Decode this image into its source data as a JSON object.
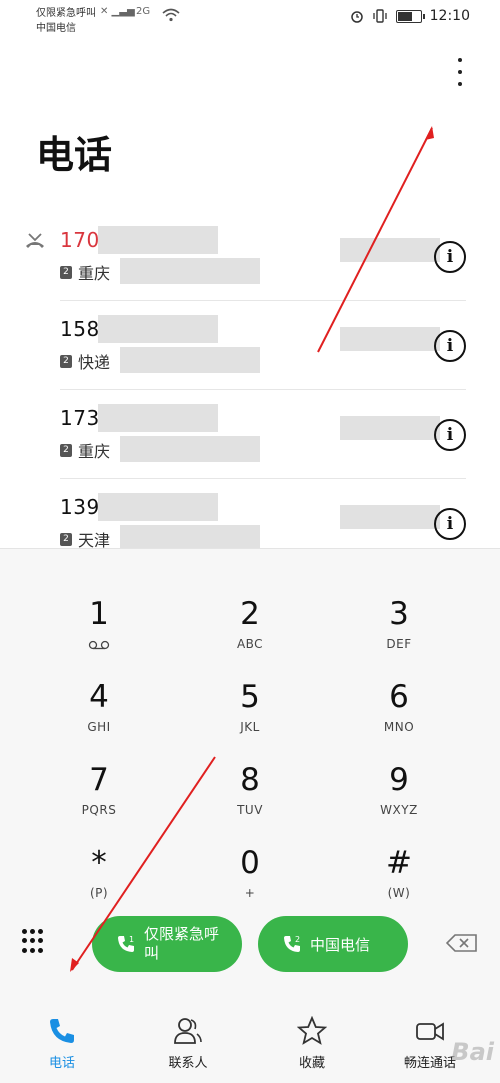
{
  "status_bar": {
    "carrier_line1": "仅限紧急呼叫",
    "carrier_line2": "中国电信",
    "network": "2G",
    "time": "12:10",
    "battery_level": 0.7
  },
  "header": {
    "title": "电话"
  },
  "call_log": [
    {
      "number": "170",
      "location": "重庆",
      "missed": true
    },
    {
      "number": "158",
      "location": "快递",
      "missed": false
    },
    {
      "number": "173",
      "location": "重庆",
      "missed": false
    },
    {
      "number": "139",
      "location": "天津",
      "missed": false
    }
  ],
  "info_glyph": "i",
  "dialpad": {
    "keys": [
      {
        "digit": "1",
        "letters": ""
      },
      {
        "digit": "2",
        "letters": "ABC"
      },
      {
        "digit": "3",
        "letters": "DEF"
      },
      {
        "digit": "4",
        "letters": "GHI"
      },
      {
        "digit": "5",
        "letters": "JKL"
      },
      {
        "digit": "6",
        "letters": "MNO"
      },
      {
        "digit": "7",
        "letters": "PQRS"
      },
      {
        "digit": "8",
        "letters": "TUV"
      },
      {
        "digit": "9",
        "letters": "WXYZ"
      },
      {
        "digit": "*",
        "letters": "(P)"
      },
      {
        "digit": "0",
        "letters": "+"
      },
      {
        "digit": "#",
        "letters": "(W)"
      }
    ],
    "call_buttons": [
      {
        "sim": "1",
        "label_line1": "仅限紧急呼",
        "label_line2": "叫"
      },
      {
        "sim": "2",
        "label_line1": "中国电信",
        "label_line2": ""
      }
    ]
  },
  "bottom_nav": [
    {
      "label": "电话",
      "icon": "phone-icon",
      "active": true
    },
    {
      "label": "联系人",
      "icon": "contacts-icon",
      "active": false
    },
    {
      "label": "收藏",
      "icon": "star-icon",
      "active": false
    },
    {
      "label": "畅连通话",
      "icon": "video-call-icon",
      "active": false
    }
  ],
  "colors": {
    "accent": "#1a8fe3",
    "call_green": "#39b54a",
    "missed_red": "#d9363e"
  },
  "watermark": "Bai"
}
